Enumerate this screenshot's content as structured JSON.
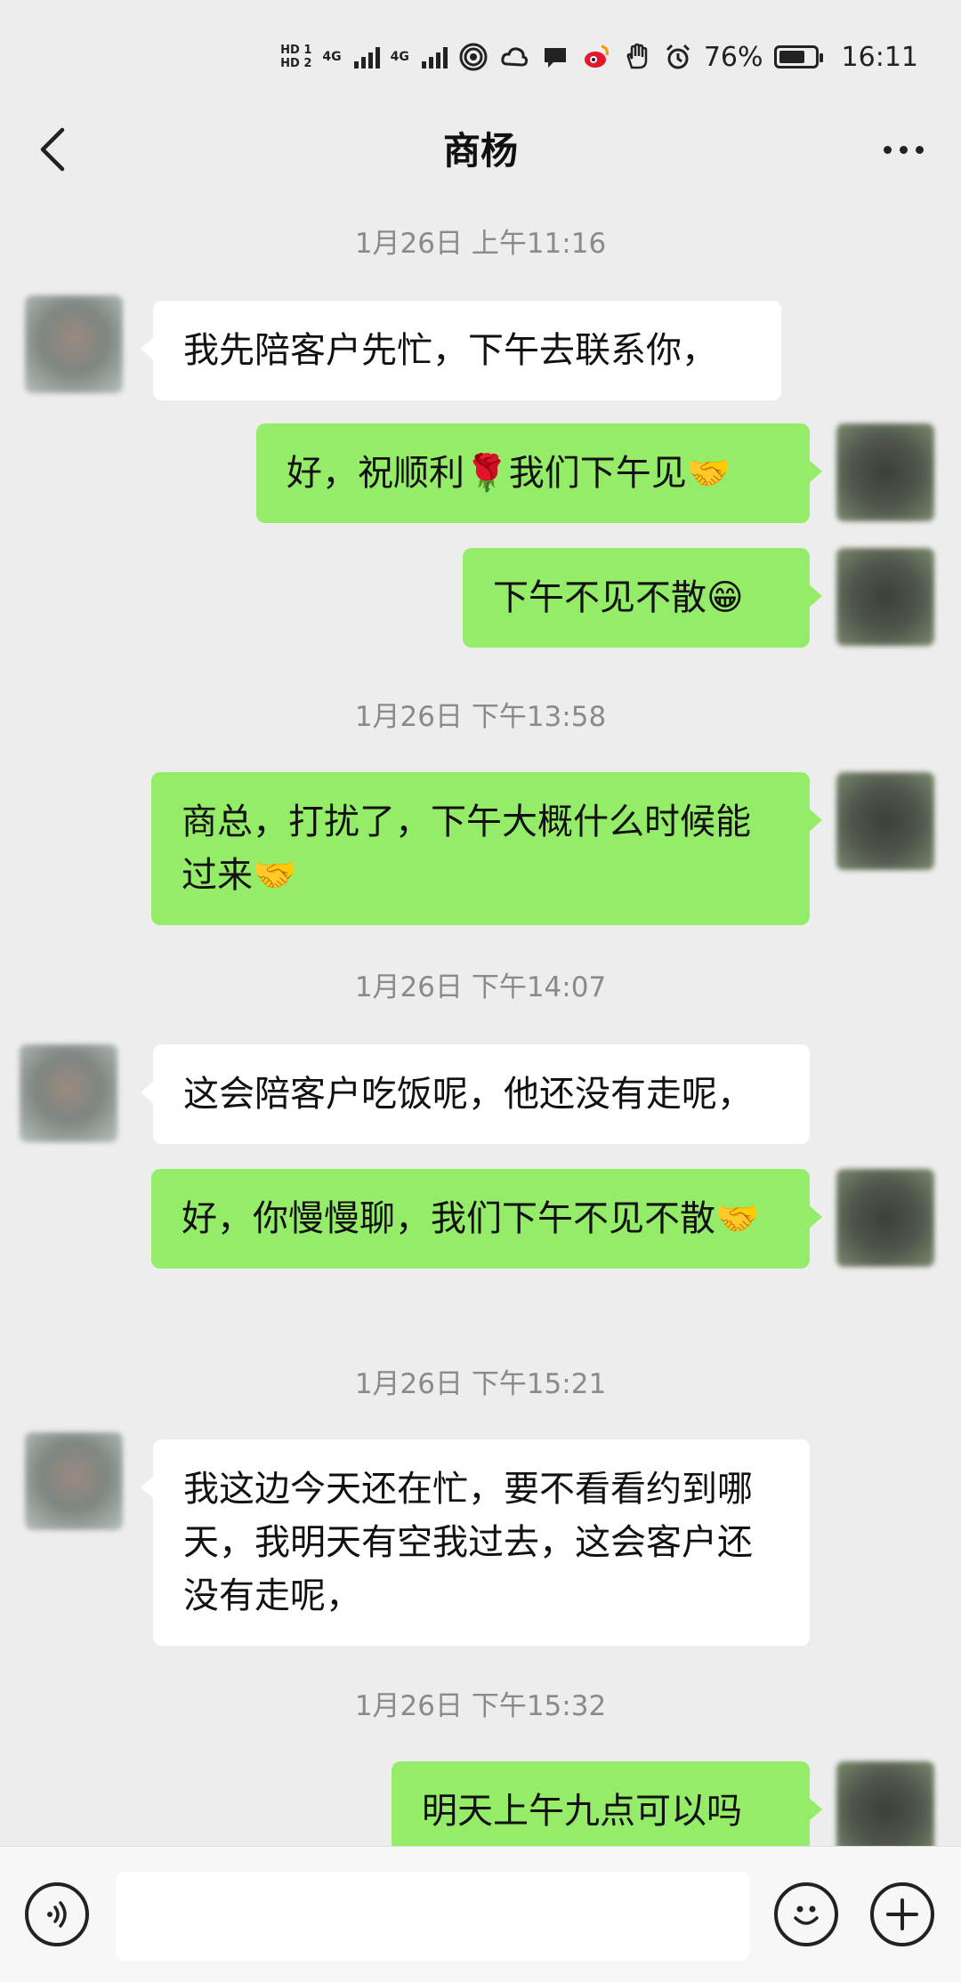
{
  "status_bar": {
    "hd1": "HD 1",
    "hd2": "HD 2",
    "net1": "4G",
    "net2": "4G",
    "battery": "76%",
    "battery_level": 0.76,
    "time": "16:11"
  },
  "header": {
    "title": "商杨"
  },
  "messages": [
    {
      "type": "timestamp",
      "text": "1月26日 上午11:16"
    },
    {
      "type": "message",
      "sender": "peer",
      "text": "我先陪客户先忙，下午去联系你，"
    },
    {
      "type": "message",
      "sender": "me",
      "text": "好，祝顺利🌹我们下午见🤝"
    },
    {
      "type": "message",
      "sender": "me",
      "text": "下午不见不散😁"
    },
    {
      "type": "timestamp",
      "text": "1月26日 下午13:58"
    },
    {
      "type": "message",
      "sender": "me",
      "text": "商总，打扰了，下午大概什么时候能过来🤝"
    },
    {
      "type": "timestamp",
      "text": "1月26日 下午14:07"
    },
    {
      "type": "message",
      "sender": "peer",
      "text": "这会陪客户吃饭呢，他还没有走呢，"
    },
    {
      "type": "message",
      "sender": "me",
      "text": "好，你慢慢聊，我们下午不见不散🤝"
    },
    {
      "type": "timestamp",
      "text": "1月26日 下午15:21"
    },
    {
      "type": "message",
      "sender": "peer",
      "text": "我这边今天还在忙，要不看看约到哪天，我明天有空我过去，这会客户还没有走呢，"
    },
    {
      "type": "timestamp",
      "text": "1月26日 下午15:32"
    },
    {
      "type": "message",
      "sender": "me",
      "text": "明天上午九点可以吗"
    }
  ],
  "input_bar": {
    "voice_icon": "voice-icon",
    "emoji_icon": "emoji-icon",
    "plus_icon": "plus-icon",
    "input_value": ""
  },
  "colors": {
    "background": "#ededed",
    "my_bubble": "#95ec69",
    "peer_bubble": "#ffffff",
    "timestamp": "#8a8a8a"
  }
}
